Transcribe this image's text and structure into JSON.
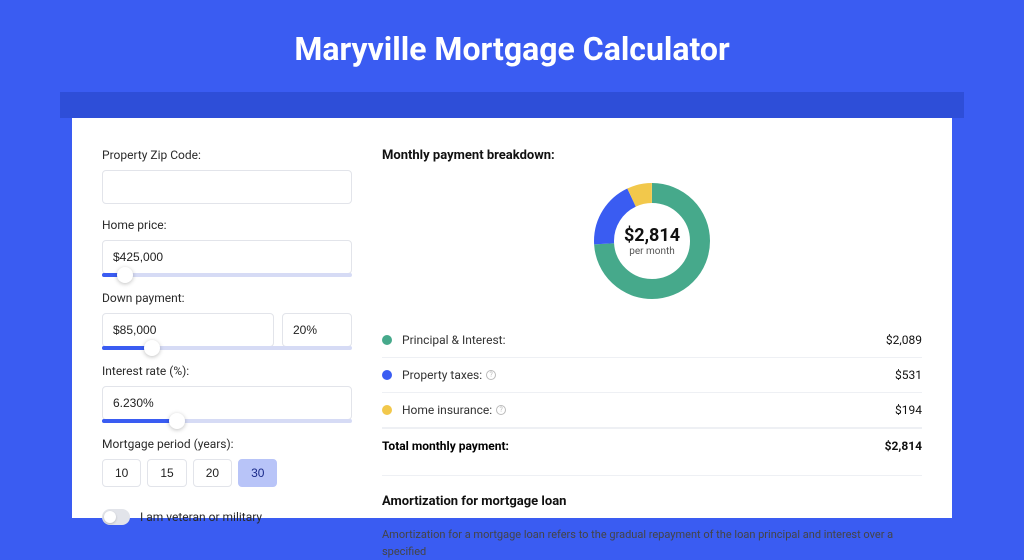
{
  "header": {
    "title": "Maryville Mortgage Calculator"
  },
  "form": {
    "zip": {
      "label": "Property Zip Code:",
      "value": ""
    },
    "home_price": {
      "label": "Home price:",
      "value": "$425,000",
      "slider_pct": 9
    },
    "down_payment": {
      "label": "Down payment:",
      "amount": "$85,000",
      "pct": "20%",
      "slider_pct": 20
    },
    "interest": {
      "label": "Interest rate (%):",
      "value": "6.230%",
      "slider_pct": 30
    },
    "period": {
      "label": "Mortgage period (years):",
      "options": [
        "10",
        "15",
        "20",
        "30"
      ],
      "selected": "30"
    },
    "veteran": {
      "label": "I am veteran or military",
      "checked": false
    }
  },
  "breakdown": {
    "title": "Monthly payment breakdown:",
    "total_amount": "$2,814",
    "total_sub": "per month",
    "items": [
      {
        "key": "pi",
        "label": "Principal & Interest:",
        "value": "$2,089",
        "color": "#46a98b",
        "pct": 74,
        "info": false
      },
      {
        "key": "tax",
        "label": "Property taxes:",
        "value": "$531",
        "color": "#3a5cf2",
        "pct": 19,
        "info": true
      },
      {
        "key": "ins",
        "label": "Home insurance:",
        "value": "$194",
        "color": "#f2c84b",
        "pct": 7,
        "info": true
      }
    ],
    "total_row": {
      "label": "Total monthly payment:",
      "value": "$2,814"
    }
  },
  "amort": {
    "title": "Amortization for mortgage loan",
    "text": "Amortization for a mortgage loan refers to the gradual repayment of the loan principal and interest over a specified"
  },
  "chart_data": {
    "type": "pie",
    "title": "Monthly payment breakdown",
    "series": [
      {
        "name": "Principal & Interest",
        "value": 2089
      },
      {
        "name": "Property taxes",
        "value": 531
      },
      {
        "name": "Home insurance",
        "value": 194
      }
    ],
    "total": 2814,
    "unit": "USD/month"
  }
}
